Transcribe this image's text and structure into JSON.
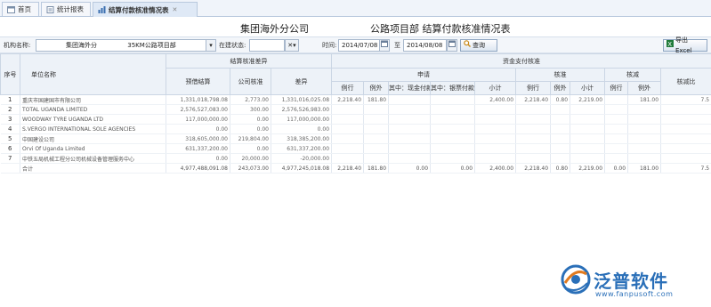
{
  "tabs": [
    {
      "label": "首页",
      "active": false
    },
    {
      "label": "统计报表",
      "active": false
    },
    {
      "label": "结算付款核准情况表",
      "active": true
    }
  ],
  "header": {
    "company": "集团海外分公司",
    "report_title": "公路项目部 结算付款核准情况表"
  },
  "filters": {
    "org_label": "机构名称:",
    "org_value_1": "集团海外分",
    "org_value_2": "35KM公路项目部",
    "status_label": "在建状态:",
    "status_value": "",
    "time_label": "时间:",
    "date_from": "2014/07/08",
    "to_label": "至",
    "date_to": "2014/08/08",
    "query_label": "查询",
    "export_label": "导出Excel"
  },
  "columns": {
    "seq": "序号",
    "unit_name": "单位名称",
    "settle_group": "结算核准差异",
    "settle": "预借结算",
    "company_approve": "公司核准",
    "diff": "差异",
    "fund_group": "资金支付核准",
    "apply": "申请",
    "approve": "核准",
    "reduce": "核减",
    "reduce_ratio": "核减比",
    "in_plan": "例行",
    "out_plan": "例外",
    "cash_pay": "其中：现金付款",
    "bill_pay": "其中：银票付款",
    "subtotal": "小计"
  },
  "rows": [
    {
      "seq": "1",
      "name": "重庆市国建国市有限公司",
      "settle": "1,331,018,798.08",
      "approve": "2,773.00",
      "diff": "1,331,016,025.08",
      "a1": "2,218.40",
      "a2": "181.80",
      "a3": "",
      "a4": "",
      "a5": "2,400.00",
      "b1": "2,218.40",
      "b2": "0.80",
      "b3": "2,219.00",
      "c1": "",
      "c2": "181.00",
      "c3": "7.5"
    },
    {
      "seq": "2",
      "name": "TOTAL UGANDA LIMITED",
      "settle": "2,576,527,083.00",
      "approve": "300.00",
      "diff": "2,576,526,983.00",
      "a1": "",
      "a2": "",
      "a3": "",
      "a4": "",
      "a5": "",
      "b1": "",
      "b2": "",
      "b3": "",
      "c1": "",
      "c2": "",
      "c3": ""
    },
    {
      "seq": "3",
      "name": "WOODWAY TYRE UGANDA LTD",
      "settle": "117,000,000.00",
      "approve": "0.00",
      "diff": "117,000,000.00",
      "a1": "",
      "a2": "",
      "a3": "",
      "a4": "",
      "a5": "",
      "b1": "",
      "b2": "",
      "b3": "",
      "c1": "",
      "c2": "",
      "c3": ""
    },
    {
      "seq": "4",
      "name": "S.VERGO INTERNATIONAL SOLE AGENCIES",
      "settle": "0.00",
      "approve": "0.00",
      "diff": "0.00",
      "a1": "",
      "a2": "",
      "a3": "",
      "a4": "",
      "a5": "",
      "b1": "",
      "b2": "",
      "b3": "",
      "c1": "",
      "c2": "",
      "c3": ""
    },
    {
      "seq": "5",
      "name": "中国建设公司",
      "settle": "318,605,000.00",
      "approve": "219,804.00",
      "diff": "318,385,200.00",
      "a1": "",
      "a2": "",
      "a3": "",
      "a4": "",
      "a5": "",
      "b1": "",
      "b2": "",
      "b3": "",
      "c1": "",
      "c2": "",
      "c3": ""
    },
    {
      "seq": "6",
      "name": "Orvi Of Uganda Limited",
      "settle": "631,337,200.00",
      "approve": "0.00",
      "diff": "631,337,200.00",
      "a1": "",
      "a2": "",
      "a3": "",
      "a4": "",
      "a5": "",
      "b1": "",
      "b2": "",
      "b3": "",
      "c1": "",
      "c2": "",
      "c3": ""
    },
    {
      "seq": "7",
      "name": "中铁五局机械工程分公司机械设备管理服务中心",
      "settle": "0.00",
      "approve": "20,000.00",
      "diff": "-20,000.00",
      "a1": "",
      "a2": "",
      "a3": "",
      "a4": "",
      "a5": "",
      "b1": "",
      "b2": "",
      "b3": "",
      "c1": "",
      "c2": "",
      "c3": ""
    }
  ],
  "total": {
    "seq": "",
    "name": "合计",
    "settle": "4,977,488,091.08",
    "approve": "243,073.00",
    "diff": "4,977,245,018.08",
    "a1": "2,218.40",
    "a2": "181.80",
    "a3": "0.00",
    "a4": "0.00",
    "a5": "2,400.00",
    "b1": "2,218.40",
    "b2": "0.80",
    "b3": "2,219.00",
    "c1": "0.00",
    "c2": "181.00",
    "c3": "7.5"
  },
  "brand": {
    "name": "泛普软件",
    "url": "www.fanpusoft.com",
    "color": "#2a6fb8"
  },
  "icons": {
    "home": "home-icon",
    "report": "report-icon",
    "calendar": "calendar-icon",
    "search": "search-icon",
    "excel": "excel-icon"
  }
}
